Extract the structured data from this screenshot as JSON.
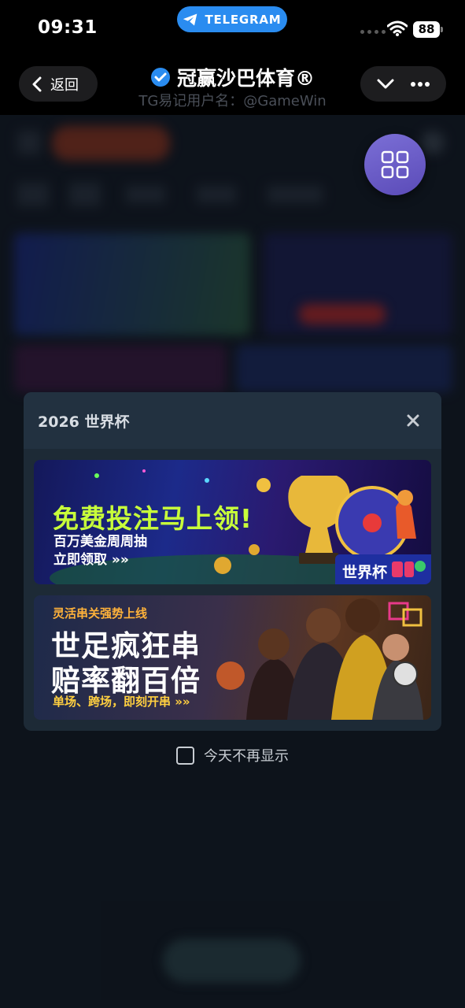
{
  "status_bar": {
    "time": "09:31",
    "telegram_label": "TELEGRAM",
    "battery": "88"
  },
  "header": {
    "back_label": "返回",
    "title": "冠赢沙巴体育®",
    "subtitle": "TG易记用户名：@GameWin"
  },
  "modal": {
    "title": "2026 世界杯",
    "banner1": {
      "headline": "免费投注马上领!",
      "line1": "百万美金周周抽",
      "line2": "立即领取 »»",
      "tag": "世界杯"
    },
    "banner2": {
      "kicker": "灵活串关强势上线",
      "headline1": "世足疯狂串",
      "headline2": "赔率翻百倍",
      "line": "单场、跨场，即刻开串 »»"
    }
  },
  "dont_show_label": "今天不再显示",
  "colors": {
    "accent": "#2a8cf0",
    "fab": "#6a5ac8",
    "modal_bg": "#1d2a36"
  }
}
